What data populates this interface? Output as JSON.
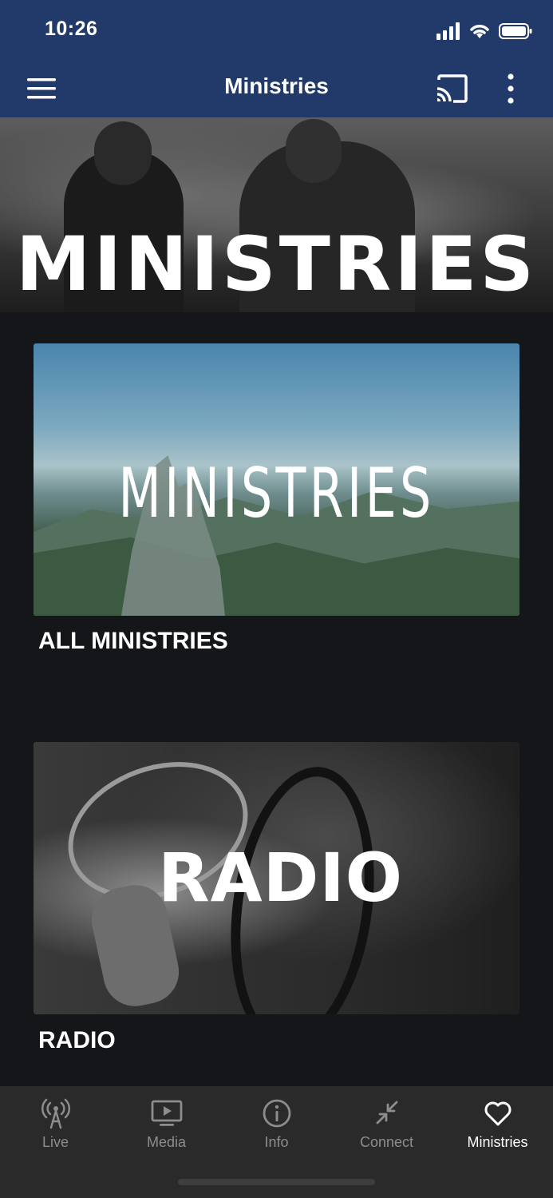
{
  "status_bar": {
    "time": "10:26"
  },
  "header": {
    "title": "Ministries",
    "menu_icon": "hamburger-menu-icon",
    "cast_icon": "cast-icon",
    "more_icon": "more-vertical-icon",
    "background_color": "#223a6a"
  },
  "hero": {
    "text": "MINISTRIES"
  },
  "cards": [
    {
      "image_text": "MINISTRIES",
      "title": "ALL MINISTRIES"
    },
    {
      "image_text": "RADIO",
      "title": "RADIO"
    }
  ],
  "tabbar": {
    "tabs": [
      {
        "label": "Live",
        "icon": "broadcast-antenna-icon",
        "active": false
      },
      {
        "label": "Media",
        "icon": "tv-play-icon",
        "active": false
      },
      {
        "label": "Info",
        "icon": "info-circle-icon",
        "active": false
      },
      {
        "label": "Connect",
        "icon": "compress-arrows-icon",
        "active": false
      },
      {
        "label": "Ministries",
        "icon": "heart-icon",
        "active": true
      }
    ]
  }
}
